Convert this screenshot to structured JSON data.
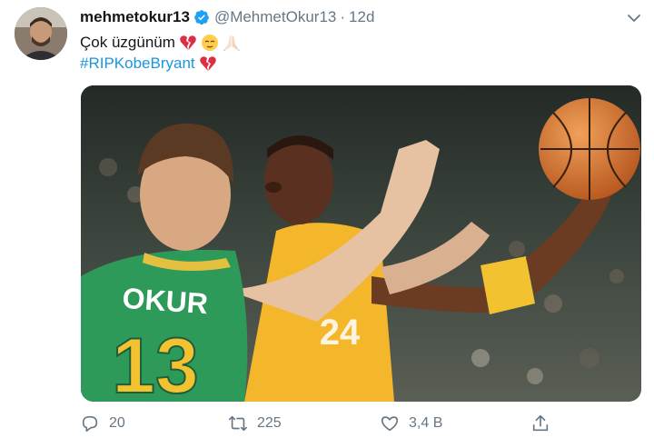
{
  "tweet": {
    "display_name": "mehmetokur13",
    "handle": "@MehmetOkur13",
    "separator": "·",
    "time": "12d",
    "text_line1": "Çok üzgünüm",
    "hashtag": "#RIPKobeBryant"
  },
  "media": {
    "jersey_front_name": "OKUR",
    "jersey_front_number": "13",
    "jersey_back_number": "24"
  },
  "actions": {
    "replies": "20",
    "retweets": "225",
    "likes": "3,4 B"
  },
  "icons": {
    "verified": "verified-badge-icon",
    "more": "chevron-down-icon",
    "reply": "reply-icon",
    "retweet": "retweet-icon",
    "like": "heart-icon",
    "share": "share-icon",
    "emoji_1": "broken-heart-emoji",
    "emoji_2": "relieved-face-emoji",
    "emoji_3": "folded-hands-emoji"
  },
  "colors": {
    "link": "#1b95e0",
    "verified": "#1da1f2",
    "muted": "#657786",
    "broken_heart": "#dd2e44"
  }
}
